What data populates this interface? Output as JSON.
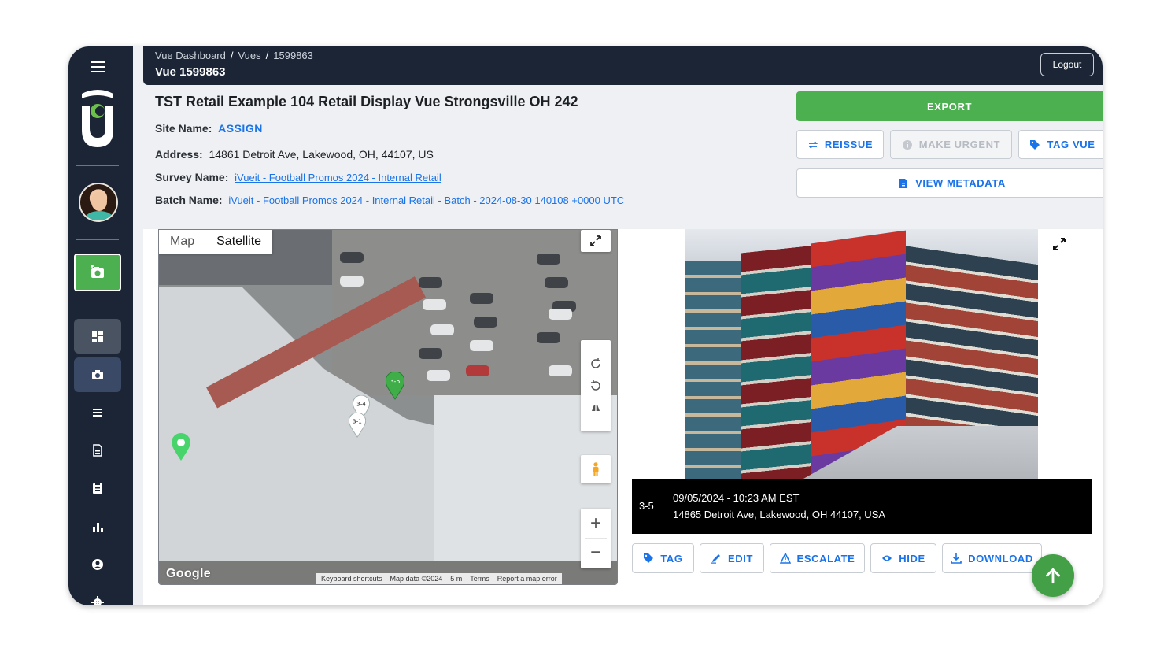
{
  "header": {
    "breadcrumbs": [
      "Vue Dashboard",
      "Vues",
      "1599863"
    ],
    "title": "Vue 1599863",
    "logout_label": "Logout"
  },
  "vue": {
    "name": "TST Retail Example 104 Retail Display Vue Strongsville OH 242",
    "site_label": "Site Name:",
    "site_value": "ASSIGN",
    "address_label": "Address:",
    "address_value": "14861 Detroit Ave, Lakewood, OH, 44107, US",
    "survey_label": "Survey Name:",
    "survey_value": "iVueit - Football Promos 2024 - Internal Retail",
    "batch_label": "Batch Name:",
    "batch_value": "iVueit - Football Promos 2024 - Internal Retail - Batch - 2024-08-30 140108 +0000 UTC"
  },
  "actions": {
    "export": "EXPORT",
    "reissue": "REISSUE",
    "make_urgent": "MAKE URGENT",
    "tag_vue": "TAG VUE",
    "view_metadata": "VIEW METADATA"
  },
  "map": {
    "tab_map": "Map",
    "tab_satellite": "Satellite",
    "active_tab": "Satellite",
    "markers": [
      "3-5",
      "3-4",
      "3-1"
    ],
    "logo": "Google",
    "footer": [
      "Keyboard shortcuts",
      "Map data ©2024",
      "5 m",
      "Terms",
      "Report a map error"
    ],
    "zoom_in": "+",
    "zoom_out": "−"
  },
  "photo": {
    "label": "3-5",
    "datetime": "09/05/2024 - 10:23 AM EST",
    "address": "14865 Detroit Ave, Lakewood, OH 44107, USA"
  },
  "photo_actions": {
    "tag": "TAG",
    "edit": "EDIT",
    "escalate": "ESCALATE",
    "hide": "HIDE",
    "download": "DOWNLOAD"
  },
  "colors": {
    "sidebar": "#1b2536",
    "accent_green": "#4caf50",
    "link_blue": "#1a73e8"
  }
}
